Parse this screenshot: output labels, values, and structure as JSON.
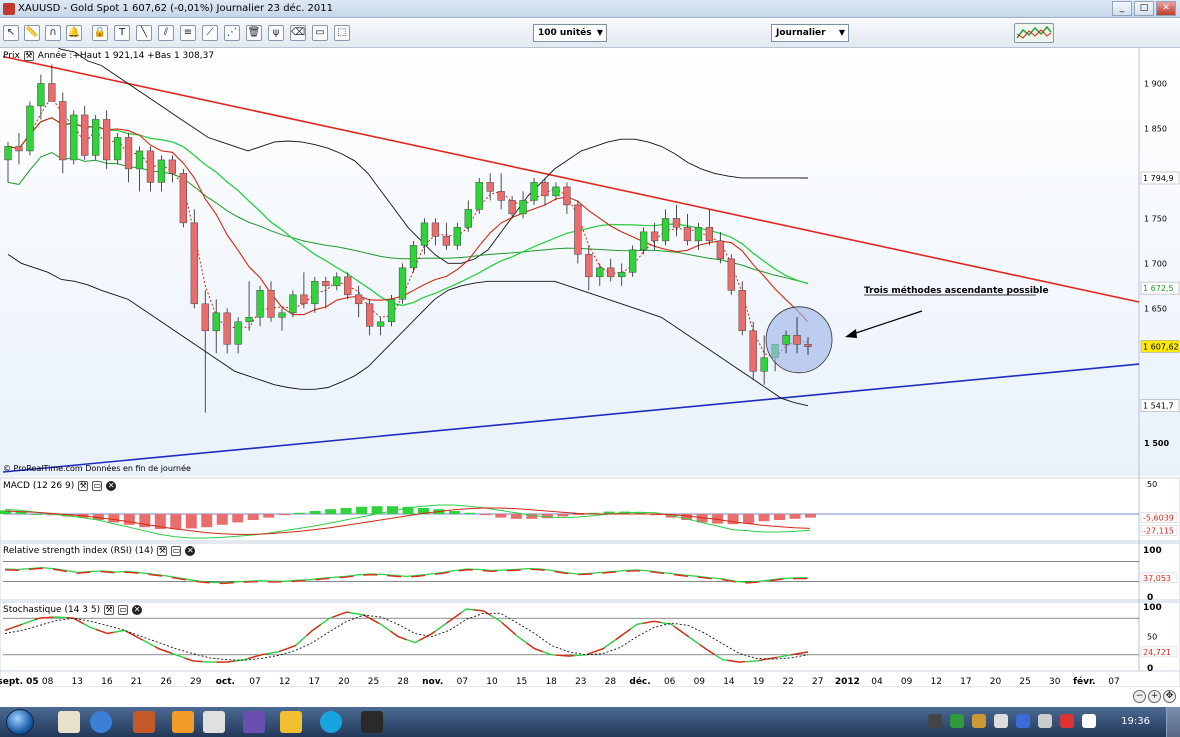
{
  "window": {
    "title": "XAUUSD - Gold Spot    1 607,62 (-0,01%)    Journalier  23 déc. 2011"
  },
  "toolbar": {
    "icons": [
      "cursor-icon",
      "ruler-icon",
      "magnet-icon",
      "alarm-bell-icon",
      "lock-icon",
      "text-tool-icon",
      "line-tool-icon",
      "channel-tool-icon",
      "fibonacci-icon",
      "trend-tool-icon",
      "fan-tool-icon",
      "delete-icon",
      "pitchfork-icon",
      "eraser-icon",
      "rectangle-tool-icon",
      "zoom-box-icon"
    ],
    "units_combo": "100 unités",
    "period_combo": "Journalier"
  },
  "colors": {
    "up": "#2fd33a",
    "down": "#e96d6d",
    "resistance": "#e2261c",
    "support": "#1f2cc0",
    "bollinger": "#111111",
    "ma_short": "#d12a10",
    "ma_mid": "#2ccf45",
    "ma_long": "#1f9a2b",
    "highlight": "#9fb7e8"
  },
  "price_panel": {
    "label": "Prix",
    "info": "Année :+Haut 1 921,14 +Bas 1 308,37",
    "source": "© ProRealTime.com  Données en fin de journée",
    "annotation": "Trois méthodes ascendante possible",
    "y_ticks": [
      "1 900",
      "1 850",
      "1 750",
      "1 700",
      "1 650",
      "1 500"
    ],
    "markers": [
      {
        "label": "1 794,9",
        "value": 1794.9,
        "color": "#000000",
        "bg": "#ffffff"
      },
      {
        "label": "1 672,5",
        "value": 1672.5,
        "color": "#1f9a2b",
        "bg": "#ffffff"
      },
      {
        "label": "1 607,62",
        "value": 1607.62,
        "color": "#000000",
        "bg": "#ffea00"
      },
      {
        "label": "1 541,7",
        "value": 1541.7,
        "color": "#000000",
        "bg": "#ffffff"
      }
    ],
    "ylim": [
      1468,
      1935
    ]
  },
  "macd_panel": {
    "label": "MACD (12 26 9)",
    "y_ticks": [
      "50"
    ],
    "markers": [
      {
        "label": "-5,6039",
        "value": -5.6039,
        "color": "#e2261c"
      },
      {
        "label": "-27,115",
        "value": -27.115,
        "color": "#e2261c"
      }
    ],
    "ylim": [
      -45,
      60
    ]
  },
  "rsi_panel": {
    "label": "Relative strength index (RSI) (14)",
    "y_ticks": [
      "100",
      "0"
    ],
    "markers": [
      {
        "label": "37,053",
        "value": 37.053,
        "color": "#e2261c"
      }
    ]
  },
  "stoch_panel": {
    "label": "Stochastique (14 3 5)",
    "y_ticks": [
      "100",
      "50",
      "0"
    ],
    "markers": [
      {
        "label": "24,721",
        "value": 24.721,
        "color": "#e2261c"
      }
    ]
  },
  "x_axis": {
    "labels": [
      {
        "t": "sept. 05",
        "bold": true
      },
      {
        "t": "08"
      },
      {
        "t": "13"
      },
      {
        "t": "16"
      },
      {
        "t": "21"
      },
      {
        "t": "26"
      },
      {
        "t": "29"
      },
      {
        "t": "oct.",
        "bold": true
      },
      {
        "t": "07"
      },
      {
        "t": "12"
      },
      {
        "t": "17"
      },
      {
        "t": "20"
      },
      {
        "t": "25"
      },
      {
        "t": "28"
      },
      {
        "t": "nov.",
        "bold": true
      },
      {
        "t": "07"
      },
      {
        "t": "10"
      },
      {
        "t": "15"
      },
      {
        "t": "18"
      },
      {
        "t": "23"
      },
      {
        "t": "28"
      },
      {
        "t": "déc.",
        "bold": true
      },
      {
        "t": "06"
      },
      {
        "t": "09"
      },
      {
        "t": "14"
      },
      {
        "t": "19"
      },
      {
        "t": "22"
      },
      {
        "t": "27"
      },
      {
        "t": "2012",
        "bold": true
      },
      {
        "t": "04"
      },
      {
        "t": "09"
      },
      {
        "t": "12"
      },
      {
        "t": "17"
      },
      {
        "t": "20"
      },
      {
        "t": "25"
      },
      {
        "t": "30"
      },
      {
        "t": "févr.",
        "bold": true
      },
      {
        "t": "07"
      }
    ]
  },
  "taskbar": {
    "clock": "19:36"
  },
  "chart_data": {
    "type": "candlestick",
    "title": "XAUUSD - Gold Spot",
    "period": "Journalier",
    "ylim": [
      1468,
      1935
    ],
    "candles": [
      {
        "o": 1815,
        "h": 1835,
        "l": 1790,
        "c": 1830
      },
      {
        "o": 1830,
        "h": 1845,
        "l": 1810,
        "c": 1825
      },
      {
        "o": 1825,
        "h": 1880,
        "l": 1820,
        "c": 1875
      },
      {
        "o": 1875,
        "h": 1910,
        "l": 1860,
        "c": 1900
      },
      {
        "o": 1900,
        "h": 1921,
        "l": 1880,
        "c": 1880
      },
      {
        "o": 1880,
        "h": 1890,
        "l": 1800,
        "c": 1815
      },
      {
        "o": 1815,
        "h": 1870,
        "l": 1810,
        "c": 1865
      },
      {
        "o": 1865,
        "h": 1875,
        "l": 1815,
        "c": 1820
      },
      {
        "o": 1820,
        "h": 1865,
        "l": 1815,
        "c": 1860
      },
      {
        "o": 1860,
        "h": 1870,
        "l": 1805,
        "c": 1815
      },
      {
        "o": 1815,
        "h": 1845,
        "l": 1810,
        "c": 1840
      },
      {
        "o": 1840,
        "h": 1845,
        "l": 1790,
        "c": 1805
      },
      {
        "o": 1805,
        "h": 1830,
        "l": 1780,
        "c": 1825
      },
      {
        "o": 1825,
        "h": 1830,
        "l": 1780,
        "c": 1790
      },
      {
        "o": 1790,
        "h": 1820,
        "l": 1780,
        "c": 1815
      },
      {
        "o": 1815,
        "h": 1820,
        "l": 1790,
        "c": 1800
      },
      {
        "o": 1800,
        "h": 1805,
        "l": 1740,
        "c": 1745
      },
      {
        "o": 1745,
        "h": 1760,
        "l": 1650,
        "c": 1655
      },
      {
        "o": 1655,
        "h": 1670,
        "l": 1534,
        "c": 1625
      },
      {
        "o": 1625,
        "h": 1660,
        "l": 1600,
        "c": 1645
      },
      {
        "o": 1645,
        "h": 1650,
        "l": 1600,
        "c": 1610
      },
      {
        "o": 1610,
        "h": 1640,
        "l": 1600,
        "c": 1635
      },
      {
        "o": 1635,
        "h": 1680,
        "l": 1625,
        "c": 1640
      },
      {
        "o": 1640,
        "h": 1675,
        "l": 1630,
        "c": 1670
      },
      {
        "o": 1670,
        "h": 1680,
        "l": 1635,
        "c": 1640
      },
      {
        "o": 1640,
        "h": 1650,
        "l": 1625,
        "c": 1645
      },
      {
        "o": 1645,
        "h": 1670,
        "l": 1640,
        "c": 1665
      },
      {
        "o": 1665,
        "h": 1690,
        "l": 1650,
        "c": 1655
      },
      {
        "o": 1655,
        "h": 1685,
        "l": 1645,
        "c": 1680
      },
      {
        "o": 1680,
        "h": 1685,
        "l": 1650,
        "c": 1675
      },
      {
        "o": 1675,
        "h": 1690,
        "l": 1670,
        "c": 1685
      },
      {
        "o": 1685,
        "h": 1690,
        "l": 1660,
        "c": 1665
      },
      {
        "o": 1665,
        "h": 1675,
        "l": 1640,
        "c": 1655
      },
      {
        "o": 1655,
        "h": 1660,
        "l": 1620,
        "c": 1630
      },
      {
        "o": 1630,
        "h": 1640,
        "l": 1620,
        "c": 1635
      },
      {
        "o": 1635,
        "h": 1665,
        "l": 1630,
        "c": 1660
      },
      {
        "o": 1660,
        "h": 1700,
        "l": 1655,
        "c": 1695
      },
      {
        "o": 1695,
        "h": 1725,
        "l": 1690,
        "c": 1720
      },
      {
        "o": 1720,
        "h": 1750,
        "l": 1710,
        "c": 1745
      },
      {
        "o": 1745,
        "h": 1750,
        "l": 1720,
        "c": 1730
      },
      {
        "o": 1730,
        "h": 1745,
        "l": 1715,
        "c": 1720
      },
      {
        "o": 1720,
        "h": 1745,
        "l": 1715,
        "c": 1740
      },
      {
        "o": 1740,
        "h": 1770,
        "l": 1735,
        "c": 1760
      },
      {
        "o": 1760,
        "h": 1795,
        "l": 1755,
        "c": 1790
      },
      {
        "o": 1790,
        "h": 1800,
        "l": 1770,
        "c": 1780
      },
      {
        "o": 1780,
        "h": 1800,
        "l": 1760,
        "c": 1770
      },
      {
        "o": 1770,
        "h": 1775,
        "l": 1750,
        "c": 1755
      },
      {
        "o": 1755,
        "h": 1780,
        "l": 1750,
        "c": 1770
      },
      {
        "o": 1770,
        "h": 1795,
        "l": 1765,
        "c": 1790
      },
      {
        "o": 1790,
        "h": 1795,
        "l": 1765,
        "c": 1775
      },
      {
        "o": 1775,
        "h": 1790,
        "l": 1770,
        "c": 1785
      },
      {
        "o": 1785,
        "h": 1790,
        "l": 1755,
        "c": 1765
      },
      {
        "o": 1765,
        "h": 1770,
        "l": 1700,
        "c": 1710
      },
      {
        "o": 1710,
        "h": 1720,
        "l": 1670,
        "c": 1685
      },
      {
        "o": 1685,
        "h": 1700,
        "l": 1675,
        "c": 1695
      },
      {
        "o": 1695,
        "h": 1705,
        "l": 1680,
        "c": 1685
      },
      {
        "o": 1685,
        "h": 1700,
        "l": 1675,
        "c": 1690
      },
      {
        "o": 1690,
        "h": 1720,
        "l": 1685,
        "c": 1715
      },
      {
        "o": 1715,
        "h": 1740,
        "l": 1710,
        "c": 1735
      },
      {
        "o": 1735,
        "h": 1745,
        "l": 1715,
        "c": 1725
      },
      {
        "o": 1725,
        "h": 1760,
        "l": 1720,
        "c": 1750
      },
      {
        "o": 1750,
        "h": 1765,
        "l": 1730,
        "c": 1740
      },
      {
        "o": 1740,
        "h": 1755,
        "l": 1720,
        "c": 1725
      },
      {
        "o": 1725,
        "h": 1745,
        "l": 1715,
        "c": 1740
      },
      {
        "o": 1740,
        "h": 1760,
        "l": 1720,
        "c": 1725
      },
      {
        "o": 1725,
        "h": 1735,
        "l": 1700,
        "c": 1705
      },
      {
        "o": 1705,
        "h": 1710,
        "l": 1665,
        "c": 1670
      },
      {
        "o": 1670,
        "h": 1680,
        "l": 1620,
        "c": 1625
      },
      {
        "o": 1625,
        "h": 1635,
        "l": 1570,
        "c": 1580
      },
      {
        "o": 1580,
        "h": 1620,
        "l": 1565,
        "c": 1595
      },
      {
        "o": 1595,
        "h": 1610,
        "l": 1580,
        "c": 1610
      },
      {
        "o": 1610,
        "h": 1625,
        "l": 1600,
        "c": 1620
      },
      {
        "o": 1620,
        "h": 1640,
        "l": 1600,
        "c": 1610
      },
      {
        "o": 1610,
        "h": 1618,
        "l": 1598,
        "c": 1607.62
      }
    ],
    "bollinger_upper": [
      1965,
      1960,
      1950,
      1945,
      1938,
      1935,
      1925,
      1920,
      1910,
      1900,
      1890,
      1880,
      1870,
      1860,
      1850,
      1840,
      1835,
      1830,
      1825,
      1830,
      1835,
      1836,
      1835,
      1832,
      1828,
      1822,
      1814,
      1800,
      1780,
      1760,
      1740,
      1725,
      1710,
      1700,
      1700,
      1705,
      1715,
      1735,
      1755,
      1775,
      1790,
      1805,
      1815,
      1825,
      1830,
      1835,
      1838,
      1838,
      1835,
      1830,
      1822,
      1812,
      1805,
      1800,
      1797,
      1795,
      1795,
      1795,
      1795,
      1795,
      1794.9
    ],
    "bollinger_lower": [
      1710,
      1700,
      1695,
      1690,
      1682,
      1680,
      1676,
      1670,
      1665,
      1660,
      1650,
      1640,
      1630,
      1620,
      1610,
      1600,
      1590,
      1580,
      1575,
      1570,
      1565,
      1562,
      1560,
      1560,
      1562,
      1568,
      1575,
      1585,
      1600,
      1615,
      1630,
      1645,
      1660,
      1670,
      1675,
      1678,
      1680,
      1680,
      1680,
      1680,
      1680,
      1680,
      1675,
      1670,
      1665,
      1660,
      1655,
      1650,
      1645,
      1640,
      1630,
      1620,
      1610,
      1600,
      1590,
      1580,
      1570,
      1560,
      1550,
      1545,
      1541.7
    ],
    "resistance_line": {
      "x": [
        0,
        1139
      ],
      "y": [
        1930,
        1657
      ]
    },
    "support_line": {
      "x": [
        0,
        1139
      ],
      "y": [
        1468,
        1588
      ]
    }
  },
  "macd_data": {
    "hist": [
      6,
      4,
      0,
      -2,
      -4,
      -6,
      -10,
      -14,
      -18,
      -22,
      -25,
      -25,
      -24,
      -22,
      -18,
      -14,
      -10,
      -6,
      -2,
      2,
      5,
      8,
      10,
      12,
      13,
      13,
      12,
      10,
      8,
      5,
      2,
      -2,
      -6,
      -8,
      -8,
      -7,
      -4,
      -1,
      2,
      4,
      4,
      2,
      -2,
      -6,
      -10,
      -14,
      -16,
      -17,
      -16,
      -12,
      -10,
      -8,
      -6
    ],
    "macd": [
      8,
      6,
      3,
      0,
      -3,
      -6,
      -10,
      -16,
      -22,
      -28,
      -34,
      -38,
      -40,
      -40,
      -39,
      -37,
      -35,
      -32,
      -28,
      -24,
      -20,
      -15,
      -10,
      -5,
      0,
      5,
      10,
      13,
      15,
      15,
      13,
      10,
      6,
      2,
      -2,
      -5,
      -6,
      -5,
      -3,
      0,
      2,
      3,
      2,
      -2,
      -8,
      -14,
      -20,
      -26,
      -28,
      -30,
      -30,
      -29,
      -27.115
    ],
    "signal": [
      5,
      4,
      3,
      1,
      -1,
      -3,
      -6,
      -9,
      -13,
      -17,
      -21,
      -25,
      -28,
      -31,
      -33,
      -34,
      -34,
      -33,
      -31,
      -29,
      -26,
      -23,
      -19,
      -15,
      -11,
      -7,
      -3,
      1,
      4,
      7,
      9,
      10,
      10,
      9,
      7,
      5,
      3,
      1,
      0,
      0,
      0,
      0,
      0,
      -1,
      -3,
      -6,
      -9,
      -13,
      -16,
      -19,
      -21,
      -23,
      -24
    ]
  },
  "rsi_data": {
    "values": [
      55,
      54,
      56,
      58,
      56,
      52,
      48,
      50,
      51,
      49,
      50,
      48,
      45,
      42,
      38,
      34,
      30,
      28,
      27,
      29,
      30,
      31,
      30,
      30,
      32,
      33,
      36,
      38,
      40,
      43,
      45,
      44,
      42,
      40,
      42,
      45,
      48,
      52,
      55,
      54,
      52,
      53,
      54,
      56,
      55,
      52,
      48,
      45,
      46,
      48,
      50,
      52,
      53,
      51,
      48,
      45,
      42,
      40,
      37,
      35,
      30,
      28,
      30,
      33,
      36,
      37,
      37.053
    ]
  },
  "stoch_data": {
    "k": [
      60,
      70,
      80,
      82,
      80,
      65,
      55,
      60,
      45,
      30,
      20,
      10,
      8,
      8,
      12,
      20,
      25,
      35,
      60,
      80,
      90,
      85,
      70,
      50,
      40,
      55,
      75,
      95,
      92,
      75,
      50,
      30,
      20,
      18,
      20,
      30,
      50,
      70,
      75,
      70,
      50,
      30,
      12,
      8,
      10,
      15,
      20,
      24.721
    ],
    "d": [
      55,
      60,
      68,
      76,
      80,
      75,
      68,
      60,
      50,
      40,
      30,
      22,
      15,
      12,
      11,
      14,
      19,
      27,
      40,
      58,
      75,
      85,
      82,
      70,
      55,
      50,
      60,
      78,
      88,
      88,
      72,
      55,
      35,
      25,
      20,
      22,
      32,
      50,
      65,
      72,
      68,
      55,
      38,
      22,
      14,
      13,
      15,
      20
    ]
  }
}
